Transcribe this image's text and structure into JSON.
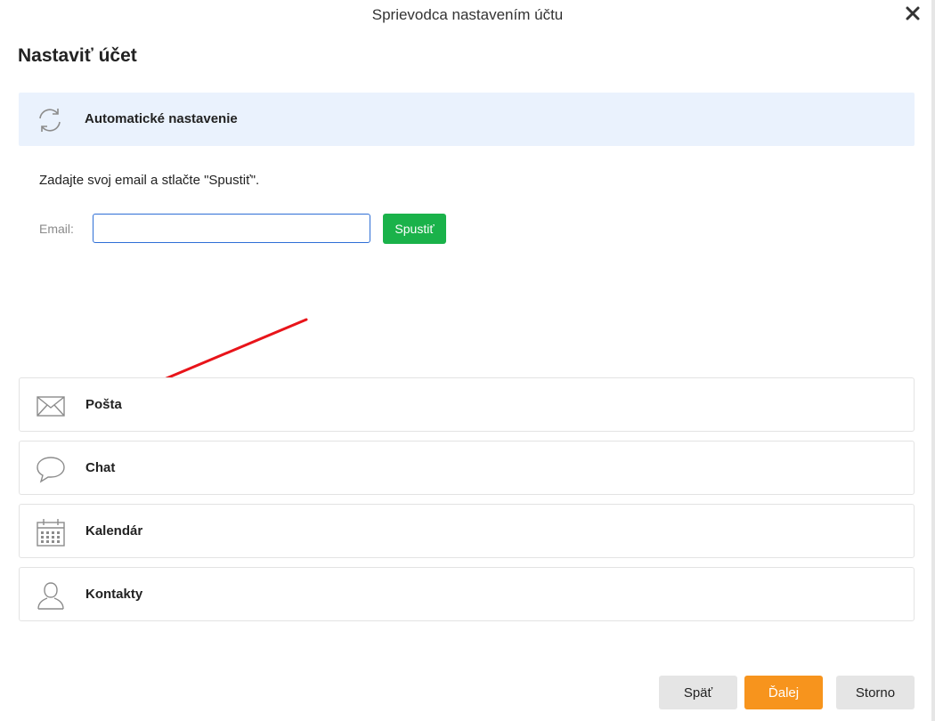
{
  "window": {
    "title": "Sprievodca nastavením účtu",
    "close_icon": "close-icon"
  },
  "page": {
    "heading": "Nastaviť účet"
  },
  "auto_setup": {
    "icon": "sync-icon",
    "label": "Automatické nastavenie",
    "instruction": "Zadajte svoj email a stlačte \"Spustiť\".",
    "email_label": "Email:",
    "email_value": "",
    "run_button": "Spustiť"
  },
  "categories": [
    {
      "icon": "mail-icon",
      "label": "Pošta"
    },
    {
      "icon": "chat-icon",
      "label": "Chat"
    },
    {
      "icon": "calendar-icon",
      "label": "Kalendár"
    },
    {
      "icon": "contact-icon",
      "label": "Kontakty"
    }
  ],
  "footer": {
    "back": "Späť",
    "next": "Ďalej",
    "cancel": "Storno"
  },
  "colors": {
    "accent_green": "#1ab24a",
    "accent_orange": "#f7941d",
    "auto_panel_bg": "#eaf2fd",
    "annotation_arrow": "#e8141a"
  }
}
